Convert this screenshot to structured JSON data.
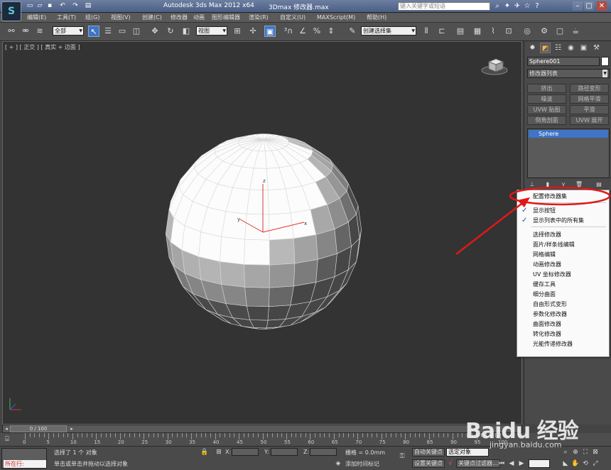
{
  "app": {
    "logo": "S",
    "title": "Autodesk 3ds Max  2012 x64",
    "file": "3Dmax 修改器.max",
    "search_placeholder": "键入关键字或短语"
  },
  "menu": [
    "编辑(E)",
    "工具(T)",
    "组(G)",
    "视图(V)",
    "创建(C)",
    "修改器",
    "动画",
    "图形编辑器",
    "渲染(R)",
    "自定义(U)",
    "MAXScript(M)",
    "帮助(H)"
  ],
  "toolbar": {
    "selection_filter": "全部",
    "ref_coord": "视图",
    "named_selection": "创建选择集"
  },
  "viewport": {
    "label": "[ + ] [ 正交 ] [ 真实 + 边面 ]",
    "axis_x": "x",
    "axis_y": "y",
    "axis_z": "z"
  },
  "command_panel": {
    "object_name": "Sphere001",
    "modifier_list": "修改器列表",
    "buttons": [
      "挤出",
      "路径变形",
      "噪波",
      "网格平滑",
      "UVW 贴图",
      "平滑",
      "倒角剖面",
      "UVW 展开"
    ],
    "stack_item": "Sphere"
  },
  "context_menu": {
    "items": [
      {
        "label": "配置修改器集",
        "checked": false
      },
      {
        "label": "显示按钮",
        "checked": true
      },
      {
        "label": "显示列表中的所有集",
        "checked": true
      },
      {
        "label": "选择修改器",
        "checked": false
      },
      {
        "label": "面片/样条线编辑",
        "checked": false
      },
      {
        "label": "网格编辑",
        "checked": false
      },
      {
        "label": "动画修改器",
        "checked": false
      },
      {
        "label": "UV 坐标修改器",
        "checked": false
      },
      {
        "label": "缓存工具",
        "checked": false
      },
      {
        "label": "细分曲面",
        "checked": false
      },
      {
        "label": "自由形式变形",
        "checked": false
      },
      {
        "label": "参数化修改器",
        "checked": false
      },
      {
        "label": "曲面修改器",
        "checked": false
      },
      {
        "label": "转化修改器",
        "checked": false
      },
      {
        "label": "光能传递修改器",
        "checked": false
      }
    ],
    "check_glyph": "✓"
  },
  "timeline": {
    "position": "0 / 100",
    "ticks": [
      "0",
      "5",
      "10",
      "15",
      "20",
      "25",
      "30",
      "35",
      "40",
      "45",
      "50",
      "55",
      "60",
      "65",
      "70",
      "75",
      "80",
      "85",
      "90",
      "95",
      "100"
    ]
  },
  "status": {
    "mode": "所在行:",
    "selection": "选择了 1 个 对象",
    "prompt": "单击或单击并拖动以选择对象",
    "x_label": "X:",
    "y_label": "Y:",
    "z_label": "Z:",
    "grid": "栅格 = 0.0mm",
    "add_time_tag": "添加时间标记",
    "auto_key": "自动关键点",
    "selected_obj": "选定对象",
    "set_key": "设置关键点",
    "key_filters": "关键点过滤器..."
  },
  "watermark": {
    "brand": "Baidu 经验",
    "url": "jingyan.baidu.com"
  }
}
